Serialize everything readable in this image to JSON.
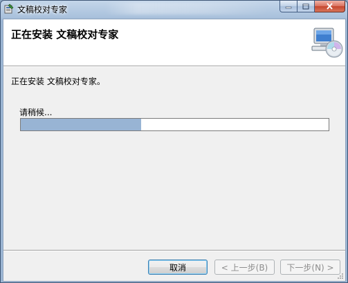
{
  "window": {
    "title": "文稿校对专家"
  },
  "caption": {
    "min_icon": "minimize-icon",
    "max_icon": "maximize-icon",
    "close_icon": "close-icon"
  },
  "banner": {
    "title": "正在安装 文稿校对专家",
    "icon": "computer-cd-icon"
  },
  "body": {
    "status": "正在安装 文稿校对专家。",
    "wait": "请稍候...",
    "progress": 0.39
  },
  "buttons": {
    "cancel": "取消",
    "back": "< 上一步(B)",
    "next": "下一步(N) >"
  },
  "colors": {
    "progress_fill": "#98b4d4",
    "title_bar": "#a9c1dc",
    "close_button": "#c5452d"
  }
}
